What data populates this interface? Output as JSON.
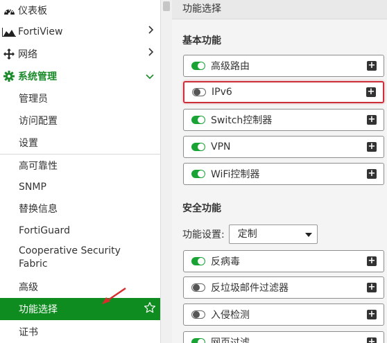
{
  "sidebar": {
    "dashboard": "仪表板",
    "fortiview": "FortiView",
    "network": "网络",
    "system": "系统管理",
    "system_items": [
      "管理员",
      "访问配置",
      "设置"
    ],
    "other_items": [
      "高可靠性",
      "SNMP",
      "替换信息",
      "FortiGuard",
      "Cooperative Security",
      "Fabric",
      "高级"
    ],
    "active_item": "功能选择",
    "certificate": "证书"
  },
  "main": {
    "header": "功能选择",
    "basic_title": "基本功能",
    "basic_features": [
      {
        "label": "高级路由",
        "enabled": true
      },
      {
        "label": "IPv6",
        "enabled": false
      },
      {
        "label": "Switch控制器",
        "enabled": true
      },
      {
        "label": "VPN",
        "enabled": true
      },
      {
        "label": "WiFi控制器",
        "enabled": true
      }
    ],
    "security_title": "安全功能",
    "setting_label": "功能设置:",
    "setting_value": "定制",
    "security_features": [
      {
        "label": "反病毒",
        "enabled": true
      },
      {
        "label": "反垃圾邮件过滤器",
        "enabled": false
      },
      {
        "label": "入侵检测",
        "enabled": false
      },
      {
        "label": "网页过滤",
        "enabled": true
      }
    ]
  },
  "colors": {
    "active_green": "#0f8c1f",
    "toggle_green": "#19a335",
    "highlight_red": "#cc2f3a"
  },
  "icons": [
    "dashboard-icon",
    "chart-icon",
    "network-move-icon",
    "gear-icon",
    "chevron-right-icon",
    "chevron-down-icon",
    "star-icon",
    "plus-icon",
    "toggle-icon"
  ]
}
